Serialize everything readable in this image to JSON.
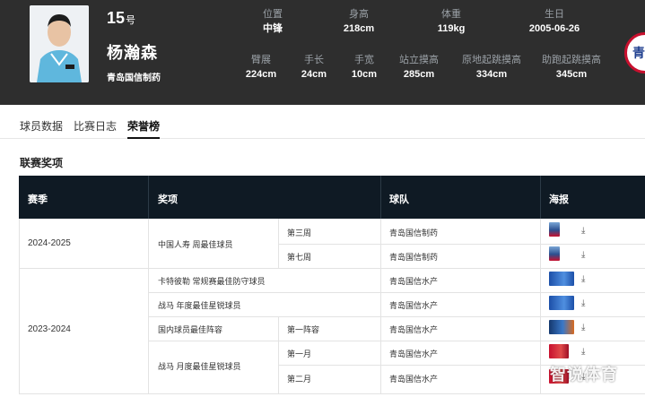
{
  "player": {
    "number": "15",
    "number_suffix": "号",
    "name": "杨瀚森",
    "team": "青岛国信制药"
  },
  "stats_row1": [
    {
      "label": "位置",
      "value": "中锋"
    },
    {
      "label": "身高",
      "value": "218cm"
    },
    {
      "label": "体重",
      "value": "119kg"
    },
    {
      "label": "生日",
      "value": "2005-06-26"
    }
  ],
  "stats_row2": [
    {
      "label": "臂展",
      "value": "224cm"
    },
    {
      "label": "手长",
      "value": "24cm"
    },
    {
      "label": "手宽",
      "value": "10cm"
    },
    {
      "label": "站立摸高",
      "value": "285cm"
    },
    {
      "label": "原地起跳摸高",
      "value": "334cm"
    },
    {
      "label": "助跑起跳摸高",
      "value": "345cm"
    }
  ],
  "team_logo_text": "青",
  "tabs": [
    "球员数据",
    "比赛日志",
    "荣誉榜"
  ],
  "section_title": "联赛奖项",
  "table": {
    "headers": [
      "赛季",
      "奖项",
      "球队",
      "海报"
    ],
    "seasons": [
      "2024-2025",
      "2023-2024"
    ],
    "rows": [
      {
        "award": "中国人寿 周最佳球员",
        "detail": "第三周",
        "team": "青岛国信制药"
      },
      {
        "award": "",
        "detail": "第七周",
        "team": "青岛国信制药"
      },
      {
        "award": "卡特彼勒 常规赛最佳防守球员",
        "detail": "",
        "team": "青岛国信水产"
      },
      {
        "award": "战马 年度最佳星锐球员",
        "detail": "",
        "team": "青岛国信水产"
      },
      {
        "award": "国内球员最佳阵容",
        "detail": "第一阵容",
        "team": "青岛国信水产"
      },
      {
        "award": "战马 月度最佳星锐球员",
        "detail": "第一月",
        "team": "青岛国信水产"
      },
      {
        "award": "",
        "detail": "第二月",
        "team": "青岛国信水产"
      }
    ]
  },
  "download_glyph": "⤓",
  "watermark": "智说体育",
  "colors": {
    "header_bg": "#2e2e2e",
    "table_header_bg": "#0f1a24",
    "accent_red": "#c8102e"
  }
}
